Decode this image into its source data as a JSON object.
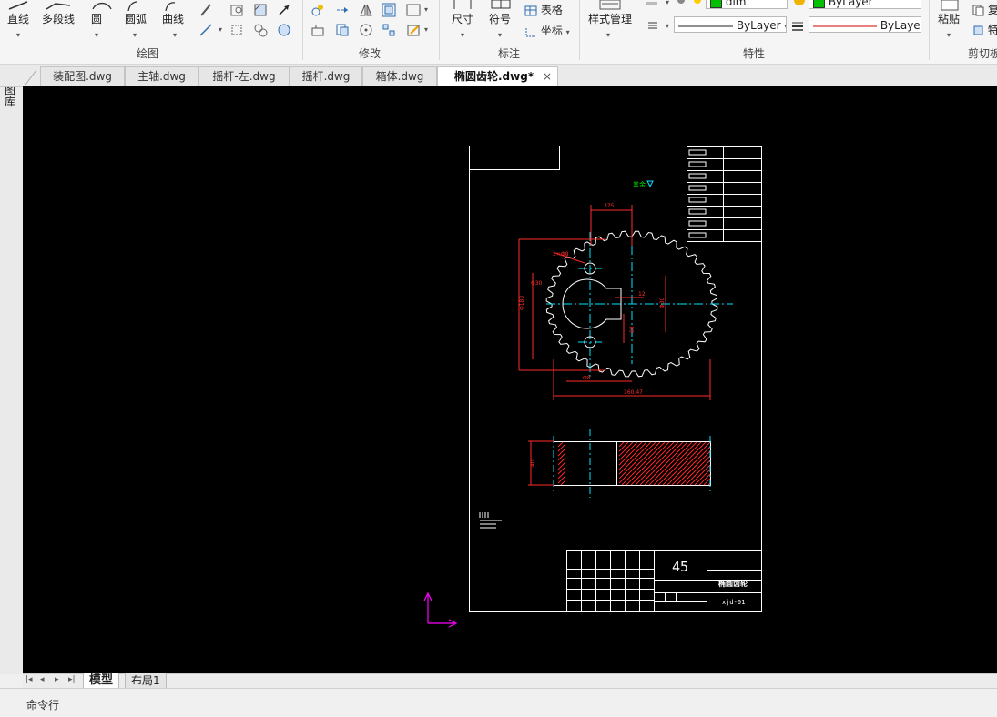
{
  "ribbon": {
    "draw_tools": {
      "line": "直线",
      "polyline": "多段线",
      "circle": "圆",
      "arc": "圆弧",
      "curve": "曲线"
    },
    "annot_tools": {
      "dimension": "尺寸",
      "symbol": "符号",
      "table": "表格",
      "coord": "坐标"
    },
    "style_tools": {
      "style_manager": "样式管理"
    },
    "clipboard": {
      "paste": "粘贴",
      "copy_abbr": "复",
      "special_abbr": "特"
    },
    "groups": {
      "draw": "绘图",
      "modify": "修改",
      "annotate": "标注",
      "properties": "特性",
      "clipboard": "剪切板"
    },
    "properties": {
      "linetype": "ByLayer",
      "lineweight": "ByLaye",
      "color_top": "ByLayer",
      "layer_top": "dim"
    },
    "colors": {
      "accent": "#2b6cb0",
      "lineweight_red": "#d00000"
    }
  },
  "tabs": [
    {
      "label": "装配图.dwg",
      "active": false
    },
    {
      "label": "主轴.dwg",
      "active": false
    },
    {
      "label": "摇杆-左.dwg",
      "active": false
    },
    {
      "label": "摇杆.dwg",
      "active": false
    },
    {
      "label": "箱体.dwg",
      "active": false
    },
    {
      "label": "椭圆齿轮.dwg*",
      "active": true,
      "close": "×"
    }
  ],
  "sidebar": {
    "label": "图库"
  },
  "drawing": {
    "material": "45",
    "part_name": "椭圆齿轮",
    "drawing_no": "xjd-01",
    "note_label": "其余",
    "dims": [
      "375",
      "2×Φ8",
      "Φ30",
      "12",
      "Φ30",
      "88",
      "Φ180",
      "160.47",
      "Φ8",
      "40"
    ],
    "colors": {
      "bg": "#000000",
      "frame": "#ffffff",
      "gear": "#ffffff",
      "center": "#00e5ff",
      "dim": "#ff2a2a",
      "hatch": "#ff2a2a",
      "ucs": "#ff00ff",
      "note": "#00e000"
    }
  },
  "layout_tabs": {
    "model": "模型",
    "layout1": "布局1",
    "nav": [
      "|◂",
      "◂",
      "▸",
      "▸|"
    ]
  },
  "command": {
    "label": "命令行"
  }
}
